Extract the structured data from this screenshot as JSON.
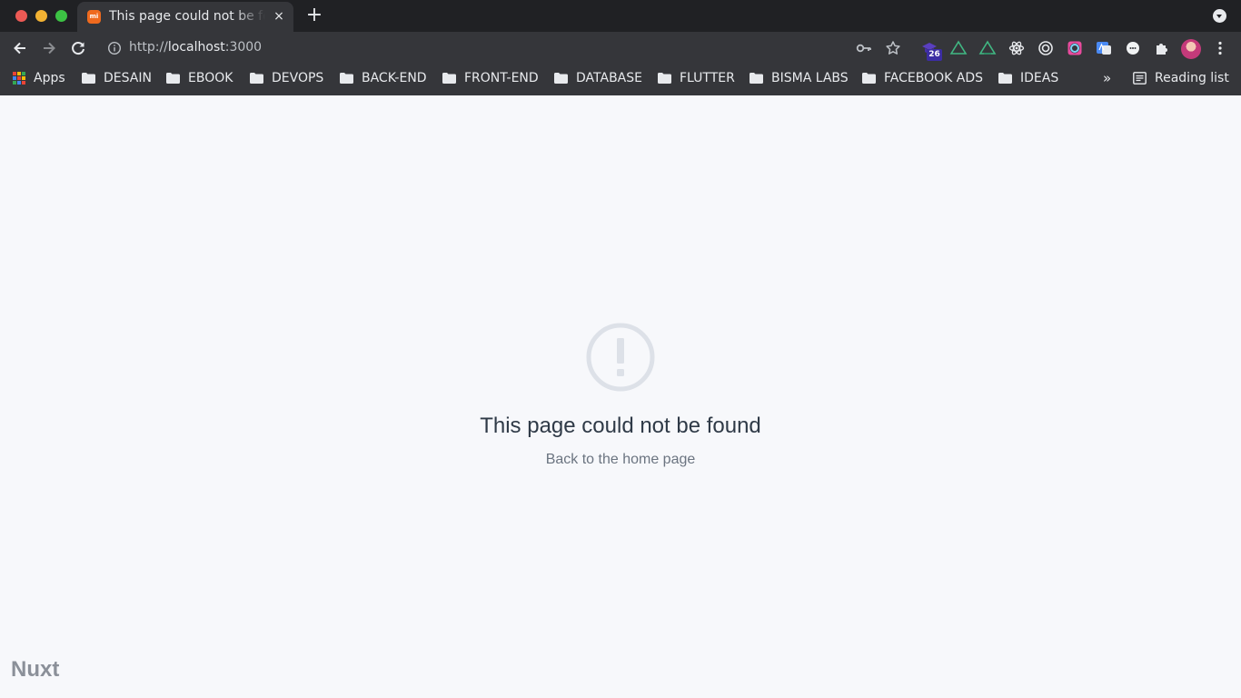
{
  "browser": {
    "tab": {
      "title": "This page could not be found",
      "favicon_text": "mi",
      "close_glyph": "×"
    },
    "new_tab_glyph": "+",
    "address_bar": {
      "scheme": "http://",
      "host": "localhost",
      "port": ":3000"
    },
    "extensions": {
      "badge_count": "26"
    },
    "bookmarks": {
      "apps_label": "Apps",
      "folders": [
        "DESAIN",
        "EBOOK",
        "DEVOPS",
        "BACK-END",
        "FRONT-END",
        "DATABASE",
        "FLUTTER",
        "BISMA LABS",
        "FACEBOOK ADS",
        "IDEAS"
      ],
      "overflow_glyph": "»",
      "reading_list_label": "Reading list"
    }
  },
  "page": {
    "icon": "exclamation-circle-icon",
    "title": "This page could not be found",
    "back_link": "Back to the home page",
    "brand": "Nuxt"
  },
  "colors": {
    "page_background": "#f7f8fb",
    "icon_gray": "#dde1e8",
    "title_text": "#2f3a47",
    "link_text": "#6b7480",
    "brand_text": "#8b9099",
    "chrome_dark": "#202124",
    "chrome_toolbar": "#35363a"
  }
}
